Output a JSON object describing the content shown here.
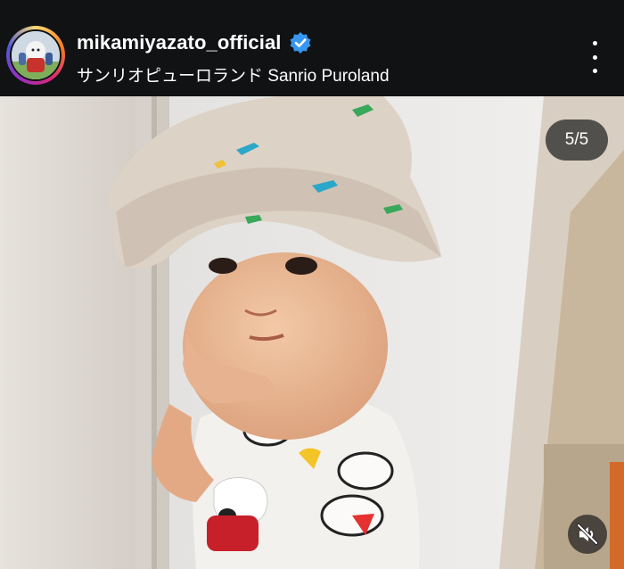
{
  "post": {
    "username": "mikamiyazato_official",
    "location": "サンリオピューロランド Sanrio Puroland",
    "verified": true
  },
  "carousel": {
    "counter": "5/5"
  },
  "icons": {
    "verified": "verified-badge-icon",
    "more": "more-options-icon",
    "mute": "muted-speaker-icon"
  },
  "colors": {
    "header_bg": "#111214",
    "verified": "#3797f0",
    "text": "#ffffff"
  }
}
